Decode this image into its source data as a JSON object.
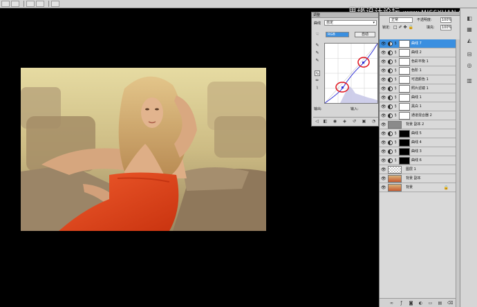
{
  "watermark": {
    "cn": "思缘设计论坛",
    "url": "www.MISSYUAN.COM"
  },
  "curves": {
    "title": "调整",
    "preset_label": "曲线",
    "preset_value": "自定",
    "channel_value": "RGB",
    "auto_label": "自动",
    "output_label": "输出:",
    "input_label": "输入:"
  },
  "layers": {
    "blend_mode": "正常",
    "opacity_label": "不透明度:",
    "opacity_value": "100%",
    "lock_label": "锁定:",
    "fill_label": "填充:",
    "fill_value": "100%",
    "items": [
      {
        "name": "曲线 7",
        "active": true,
        "type": "adj"
      },
      {
        "name": "曲线 2",
        "type": "adj"
      },
      {
        "name": "色彩平衡 1",
        "type": "adj"
      },
      {
        "name": "色阶 1",
        "type": "adj"
      },
      {
        "name": "可选颜色 1",
        "type": "adj"
      },
      {
        "name": "照片滤镜 1",
        "type": "adj"
      },
      {
        "name": "曲线 1",
        "type": "adj"
      },
      {
        "name": "黑白 1",
        "type": "adj"
      },
      {
        "name": "通道混合器 2",
        "type": "adj"
      },
      {
        "name": "背景 副本 2",
        "type": "gray"
      },
      {
        "name": "曲线 5",
        "type": "adj-black"
      },
      {
        "name": "曲线 4",
        "type": "adj-black"
      },
      {
        "name": "曲线 3",
        "type": "adj-black"
      },
      {
        "name": "曲线 6",
        "type": "adj-black"
      },
      {
        "name": "图层 1",
        "type": "checker"
      },
      {
        "name": "背景 副本",
        "type": "photo"
      },
      {
        "name": "背景",
        "type": "photo",
        "locked": true
      }
    ]
  },
  "colors": {
    "selection": "#3a8fe0",
    "annotation": "#e0101a",
    "dress": "#e2421c"
  }
}
